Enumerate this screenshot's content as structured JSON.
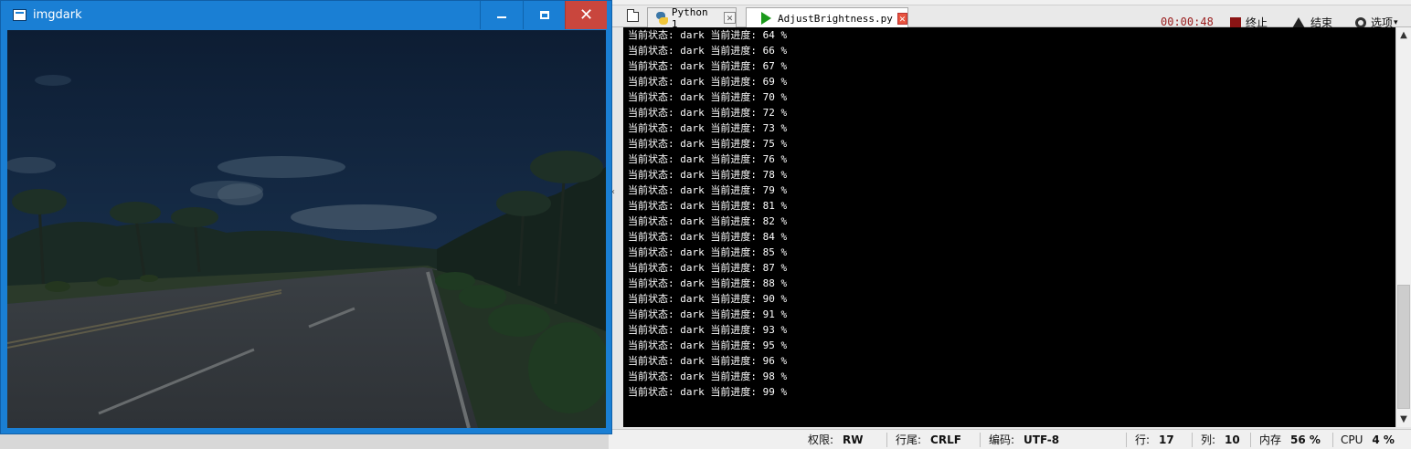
{
  "image_window": {
    "title": "imgdark",
    "min_label": "",
    "max_label": "",
    "close_label": "✕"
  },
  "ide": {
    "tabs": [
      {
        "label": "Python 1",
        "close": "✕"
      },
      {
        "label": "AdjustBrightness.py",
        "close": "✕"
      }
    ],
    "timer": "00:00:48",
    "toolbar": {
      "stop_label": "终止",
      "end_label": "结束",
      "options_label": "选项"
    },
    "console_lines": [
      "当前状态: dark 当前进度: 64 %",
      "当前状态: dark 当前进度: 66 %",
      "当前状态: dark 当前进度: 67 %",
      "当前状态: dark 当前进度: 69 %",
      "当前状态: dark 当前进度: 70 %",
      "当前状态: dark 当前进度: 72 %",
      "当前状态: dark 当前进度: 73 %",
      "当前状态: dark 当前进度: 75 %",
      "当前状态: dark 当前进度: 76 %",
      "当前状态: dark 当前进度: 78 %",
      "当前状态: dark 当前进度: 79 %",
      "当前状态: dark 当前进度: 81 %",
      "当前状态: dark 当前进度: 82 %",
      "当前状态: dark 当前进度: 84 %",
      "当前状态: dark 当前进度: 85 %",
      "当前状态: dark 当前进度: 87 %",
      "当前状态: dark 当前进度: 88 %",
      "当前状态: dark 当前进度: 90 %",
      "当前状态: dark 当前进度: 91 %",
      "当前状态: dark 当前进度: 93 %",
      "当前状态: dark 当前进度: 95 %",
      "当前状态: dark 当前进度: 96 %",
      "当前状态: dark 当前进度: 98 %",
      "当前状态: dark 当前进度: 99 %"
    ],
    "status": {
      "perm_label": "权限:",
      "perm_value": "RW",
      "eol_label": "行尾:",
      "eol_value": "CRLF",
      "enc_label": "编码:",
      "enc_value": "UTF-8",
      "row_label": "行:",
      "row_value": "17",
      "col_label": "列:",
      "col_value": "10",
      "mem_label": "内存",
      "mem_value": "56 %",
      "cpu_label": "CPU",
      "cpu_value": "4 %"
    }
  }
}
